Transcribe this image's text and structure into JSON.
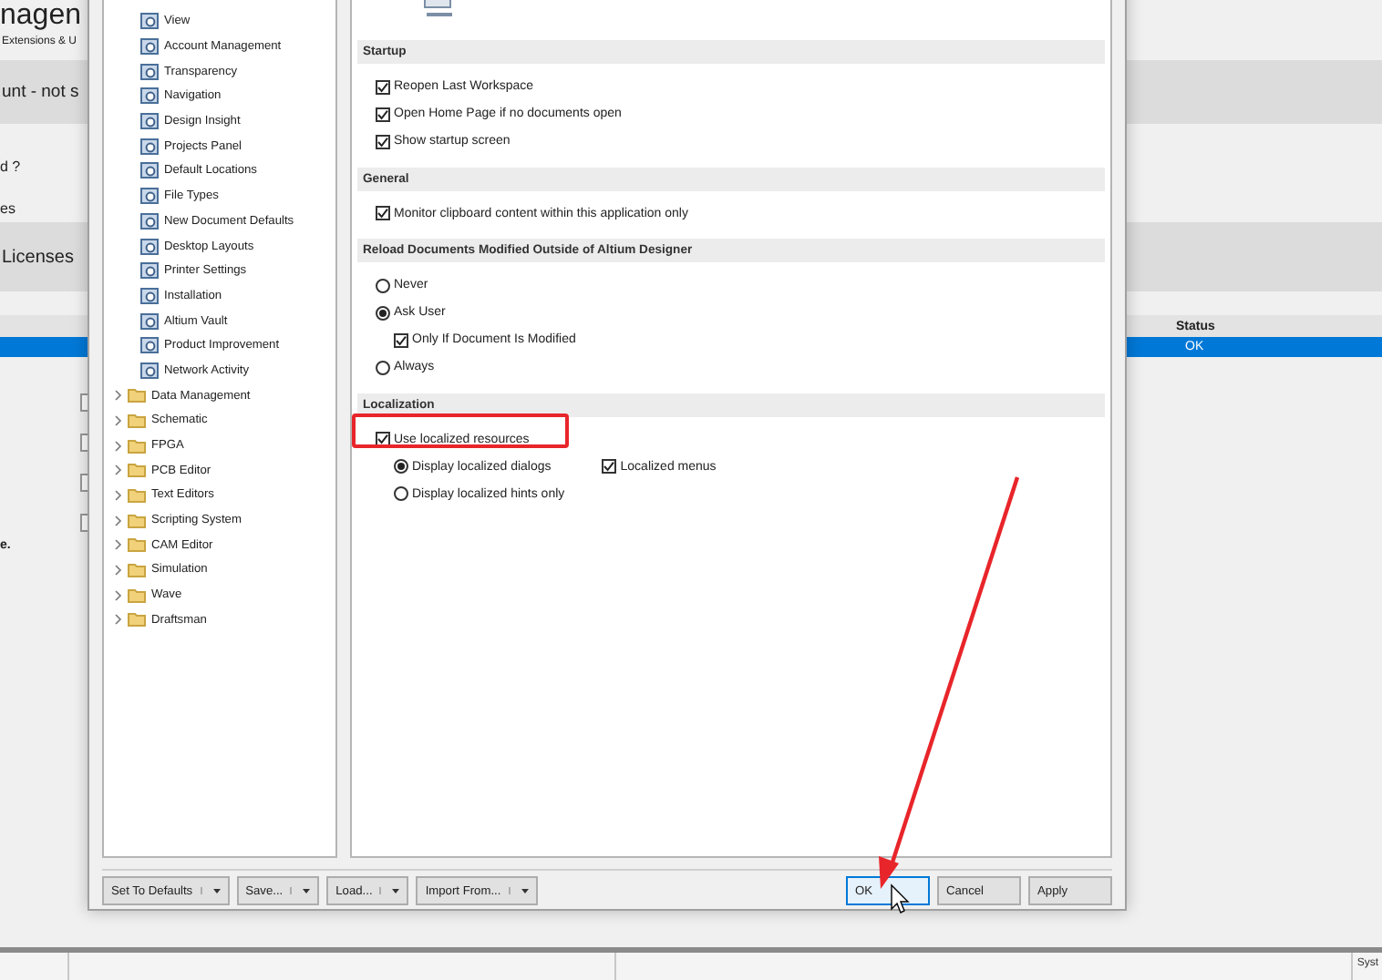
{
  "background_app": {
    "title": "nagen",
    "subtitle": "Extensions & U",
    "banner": "unt - not s",
    "lines": [
      "d ?",
      "es"
    ],
    "section_title": "Licenses",
    "table": {
      "columns": [
        "Status"
      ],
      "rows": [
        {
          "cells": [
            "OK"
          ],
          "selected": true
        }
      ]
    },
    "note": "e.",
    "status_bar": {
      "text": "Syst"
    }
  },
  "dialog": {
    "tree": [
      {
        "kind": "page",
        "label": "View"
      },
      {
        "kind": "page",
        "label": "Account Management"
      },
      {
        "kind": "page",
        "label": "Transparency"
      },
      {
        "kind": "page",
        "label": "Navigation"
      },
      {
        "kind": "page",
        "label": "Design Insight"
      },
      {
        "kind": "page",
        "label": "Projects Panel"
      },
      {
        "kind": "page",
        "label": "Default Locations"
      },
      {
        "kind": "page",
        "label": "File Types"
      },
      {
        "kind": "page",
        "label": "New Document Defaults"
      },
      {
        "kind": "page",
        "label": "Desktop Layouts"
      },
      {
        "kind": "page",
        "label": "Printer Settings"
      },
      {
        "kind": "page",
        "label": "Installation"
      },
      {
        "kind": "page",
        "label": "Altium Vault"
      },
      {
        "kind": "page",
        "label": "Product Improvement"
      },
      {
        "kind": "page",
        "label": "Network Activity"
      },
      {
        "kind": "folder",
        "label": "Data Management",
        "expanded": false
      },
      {
        "kind": "folder",
        "label": "Schematic",
        "expanded": false
      },
      {
        "kind": "folder",
        "label": "FPGA",
        "expanded": false
      },
      {
        "kind": "folder",
        "label": "PCB Editor",
        "expanded": false
      },
      {
        "kind": "folder",
        "label": "Text Editors",
        "expanded": false
      },
      {
        "kind": "folder",
        "label": "Scripting System",
        "expanded": false
      },
      {
        "kind": "folder",
        "label": "CAM Editor",
        "expanded": false
      },
      {
        "kind": "folder",
        "label": "Simulation",
        "expanded": false
      },
      {
        "kind": "folder",
        "label": "Wave",
        "expanded": false
      },
      {
        "kind": "folder",
        "label": "Draftsman",
        "expanded": false
      }
    ],
    "sections": [
      {
        "title": "Startup",
        "items": [
          {
            "kind": "checkbox",
            "label": "Reopen Last Workspace",
            "checked": true
          },
          {
            "kind": "checkbox",
            "label": "Open Home Page if no documents open",
            "checked": true
          },
          {
            "kind": "checkbox",
            "label": "Show startup screen",
            "checked": true
          }
        ]
      },
      {
        "title": "General",
        "items": [
          {
            "kind": "checkbox",
            "label": "Monitor clipboard content within this application only",
            "checked": true
          }
        ]
      },
      {
        "title": "Reload Documents Modified Outside of Altium Designer",
        "items": [
          {
            "kind": "radio",
            "label": "Never",
            "selected": false
          },
          {
            "kind": "radio",
            "label": "Ask User",
            "selected": true,
            "children": [
              {
                "kind": "checkbox",
                "label": "Only If Document Is Modified",
                "checked": true
              }
            ]
          },
          {
            "kind": "radio",
            "label": "Always",
            "selected": false
          }
        ]
      },
      {
        "title": "Localization",
        "items": [
          {
            "kind": "checkbox",
            "label": "Use localized resources",
            "checked": true,
            "children": [
              {
                "kind": "radio",
                "label": "Display localized dialogs",
                "selected": true,
                "side": {
                  "kind": "checkbox",
                  "label": "Localized menus",
                  "checked": true
                }
              },
              {
                "kind": "radio",
                "label": "Display localized hints only",
                "selected": false
              }
            ]
          }
        ]
      }
    ],
    "buttons": [
      {
        "kind": "split",
        "label": "Set To Defaults"
      },
      {
        "kind": "split",
        "label": "Save..."
      },
      {
        "kind": "split",
        "label": "Load..."
      },
      {
        "kind": "split",
        "label": "Import From..."
      },
      {
        "kind": "default",
        "label": "OK"
      },
      {
        "kind": "plain",
        "label": "Cancel"
      },
      {
        "kind": "plain",
        "label": "Apply"
      }
    ]
  }
}
